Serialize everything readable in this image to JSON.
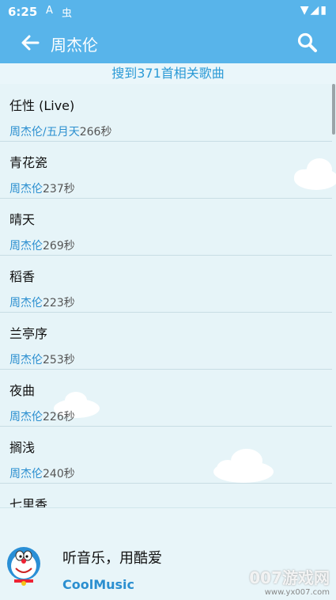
{
  "statusbar": {
    "time": "6:25",
    "icon_a": "A",
    "icon_b": "虫",
    "indicators": "▼◢▮"
  },
  "toolbar": {
    "title": "周杰伦"
  },
  "summary": "搜到371首相关歌曲",
  "songs": [
    {
      "name": "任性 (Live)",
      "artist": "周杰伦/五月天",
      "duration": "266秒"
    },
    {
      "name": "青花瓷",
      "artist": "周杰伦",
      "duration": "237秒"
    },
    {
      "name": "晴天",
      "artist": "周杰伦",
      "duration": "269秒"
    },
    {
      "name": "稻香",
      "artist": "周杰伦",
      "duration": "223秒"
    },
    {
      "name": "兰亭序",
      "artist": "周杰伦",
      "duration": "253秒"
    },
    {
      "name": "夜曲",
      "artist": "周杰伦",
      "duration": "226秒"
    },
    {
      "name": "搁浅",
      "artist": "周杰伦",
      "duration": "240秒"
    },
    {
      "name": "七里香",
      "artist": "",
      "duration": ""
    }
  ],
  "footer": {
    "slogan": "听音乐，用酷爱",
    "brand": "CoolMusic"
  },
  "watermark": {
    "line1": "007游戏网",
    "line2": "www.yx007.com"
  },
  "colors": {
    "accent": "#58b4ea",
    "link": "#2b8fd0"
  }
}
